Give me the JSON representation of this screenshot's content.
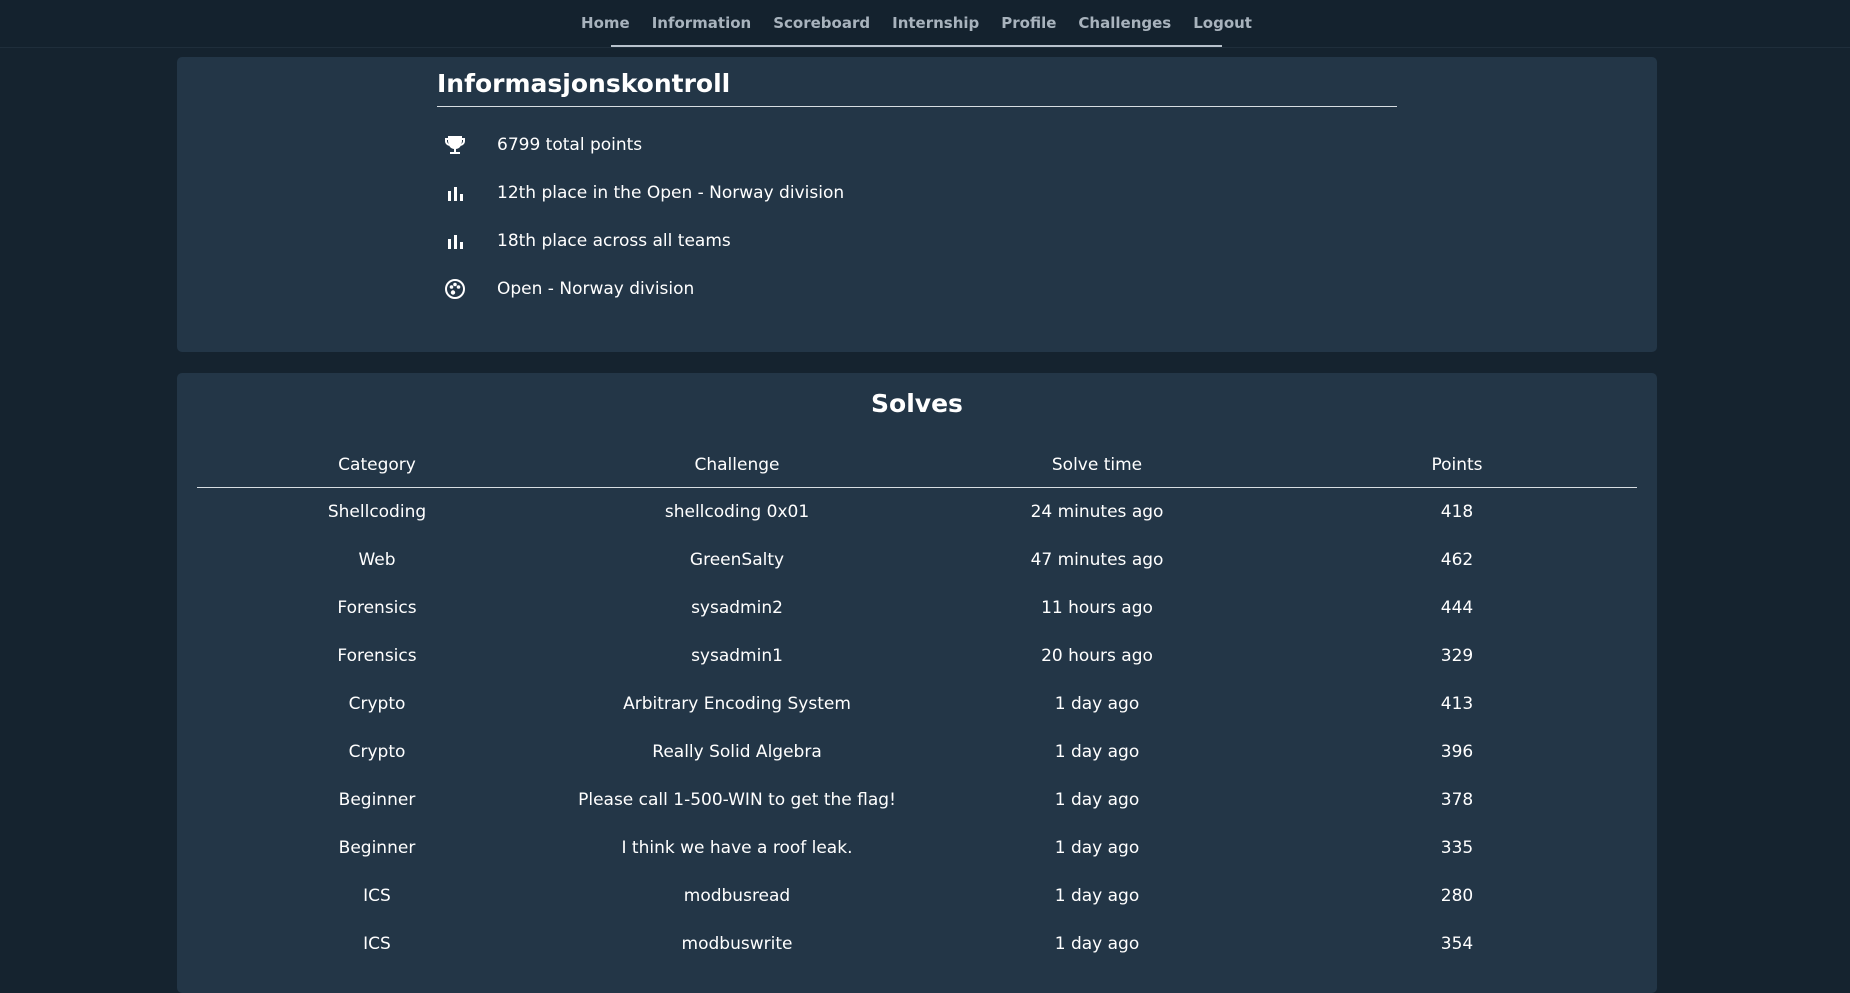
{
  "nav": {
    "items": [
      {
        "label": "Home",
        "name": "nav-home"
      },
      {
        "label": "Information",
        "name": "nav-information"
      },
      {
        "label": "Scoreboard",
        "name": "nav-scoreboard"
      },
      {
        "label": "Internship",
        "name": "nav-internship"
      },
      {
        "label": "Profile",
        "name": "nav-profile"
      },
      {
        "label": "Challenges",
        "name": "nav-challenges"
      },
      {
        "label": "Logout",
        "name": "nav-logout"
      }
    ]
  },
  "team": {
    "name": "Informasjonskontroll",
    "stats": [
      {
        "icon": "trophy-icon",
        "text": "6799 total points"
      },
      {
        "icon": "bar-chart-icon",
        "text": "12th place in the Open - Norway division"
      },
      {
        "icon": "bar-chart-icon",
        "text": "18th place across all teams"
      },
      {
        "icon": "palette-icon",
        "text": "Open - Norway division"
      }
    ]
  },
  "solves": {
    "title": "Solves",
    "columns": [
      "Category",
      "Challenge",
      "Solve time",
      "Points"
    ],
    "rows": [
      [
        "Shellcoding",
        "shellcoding 0x01",
        "24 minutes ago",
        "418"
      ],
      [
        "Web",
        "GreenSalty",
        "47 minutes ago",
        "462"
      ],
      [
        "Forensics",
        "sysadmin2",
        "11 hours ago",
        "444"
      ],
      [
        "Forensics",
        "sysadmin1",
        "20 hours ago",
        "329"
      ],
      [
        "Crypto",
        "Arbitrary Encoding System",
        "1 day ago",
        "413"
      ],
      [
        "Crypto",
        "Really Solid Algebra",
        "1 day ago",
        "396"
      ],
      [
        "Beginner",
        "Please call 1-500-WIN to get the flag!",
        "1 day ago",
        "378"
      ],
      [
        "Beginner",
        "I think we have a roof leak.",
        "1 day ago",
        "335"
      ],
      [
        "ICS",
        "modbusread",
        "1 day ago",
        "280"
      ],
      [
        "ICS",
        "modbuswrite",
        "1 day ago",
        "354"
      ]
    ]
  },
  "colors": {
    "page_bg": "#15232f",
    "card_bg": "#233647",
    "nav_text": "#a8b3bd",
    "text": "#ffffff"
  }
}
